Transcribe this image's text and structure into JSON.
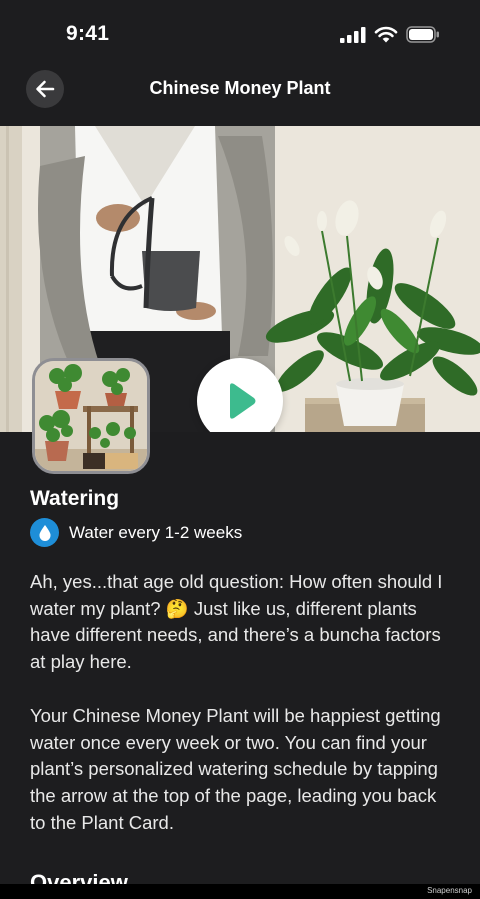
{
  "status_bar": {
    "time": "9:41"
  },
  "nav": {
    "title": "Chinese Money Plant"
  },
  "video": {},
  "care": {
    "section_title": "Watering",
    "water_text": "Water every 1-2 weeks"
  },
  "content": {
    "p1": "Ah, yes...that age old question: How often should I water my plant? 🤔 Just like us, different plants have different needs, and there’s a buncha factors at play here.",
    "p2": "Your Chinese Money Plant will be happiest getting water once every week or two. You can find your plant’s personalized watering schedule by tapping the arrow at the top of the page, leading you back to the Plant Card.",
    "next_section_partial": "Overview"
  },
  "footer": {
    "watermark": "Snapensnap"
  },
  "colors": {
    "background": "#1d1d1f",
    "water_badge": "#1e8ed8",
    "play_icon": "#3dbb8e"
  }
}
